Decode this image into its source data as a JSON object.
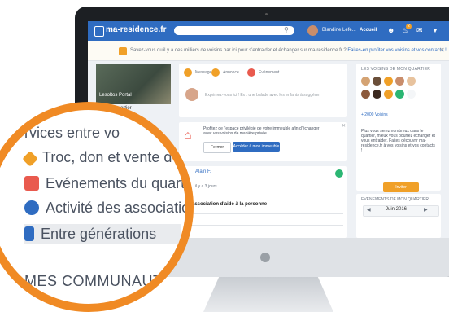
{
  "header": {
    "logo": "ma-residence.fr",
    "user_name": "Blandine Lefe...",
    "nav_home": "Accueil",
    "notifications_count": "2"
  },
  "banner": {
    "text": "Savez-vous qu'il y a des milliers de voisins par ici pour s'entraider et échanger sur ma-residence.fr ?",
    "link": "Faites-en profiter vos voisins et vos contacts !"
  },
  "left": {
    "cover_label": "Lesoltos Portal",
    "my_quarter": "Mon quartier"
  },
  "composer": {
    "tabs": [
      "Message",
      "Annonce",
      "Evènement"
    ],
    "placeholder": "Exprimez-vous ici ! Ex : une balade avec les enfants à suggérer"
  },
  "info_card": {
    "text": "Profitez de l'espace privilégié de votre immeuble afin d'échanger avec vos voisins de manière privée.",
    "close_label": "Fermer",
    "access_label": "Accéder à mon immeuble"
  },
  "post": {
    "author": "Alain F.",
    "time": "il y a 3 jours",
    "title": "association d'aide à la personne"
  },
  "neighbors": {
    "title": "LES VOISINS DE MON QUARTIER",
    "count": "+ 2000 Voisins",
    "text": "Plus vous serez nombreux dans le quartier, mieux vous pourrez échanger et vous entraider. Faites découvrir ma-residence.fr à vos voisins et vos contacts !",
    "invite_label": "Inviter"
  },
  "events": {
    "title": "EVÉNEMENTS DE MON QUARTIER",
    "month": "Juin 2016"
  },
  "magnifier": {
    "services": "rvices entre vo",
    "items": [
      {
        "label": "Troc, don et vente d'o",
        "color": "#f0a028"
      },
      {
        "label": "Evénements du quartier",
        "color": "#e95a4e"
      },
      {
        "label": "Activité des associations",
        "color": "#2f6cc1"
      },
      {
        "label": "Entre générations",
        "color": "#2f6cc1"
      }
    ],
    "communities": "MES COMMUNAUTÉS"
  }
}
